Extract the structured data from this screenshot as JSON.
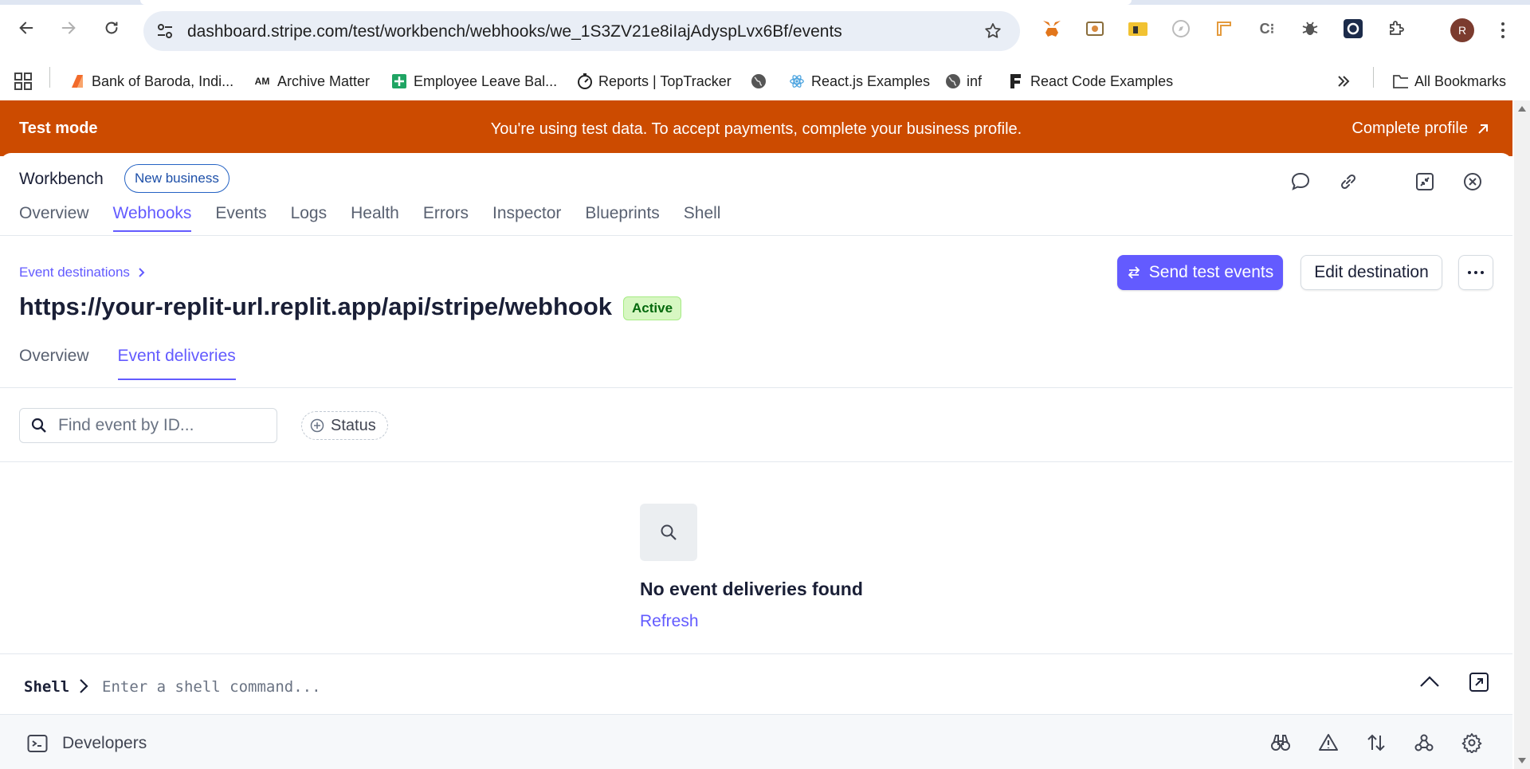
{
  "browser": {
    "url": "dashboard.stripe.com/test/workbench/webhooks/we_1S3ZV21e8iIajAdyspLvx6Bf/events",
    "avatar_letter": "R",
    "bookmarks": [
      {
        "label": "Bank of Baroda, Indi...",
        "icon": "bank-of-baroda-icon"
      },
      {
        "label": "Archive Matter",
        "icon": "archive-matter-icon"
      },
      {
        "label": "Employee Leave Bal...",
        "icon": "sheets-icon"
      },
      {
        "label": "Reports | TopTracker",
        "icon": "toptracker-icon"
      },
      {
        "label": "",
        "icon": "globe-icon"
      },
      {
        "label": "React.js Examples",
        "icon": "react-icon"
      },
      {
        "label": "inf",
        "icon": "globe-icon"
      },
      {
        "label": "React Code Examples",
        "icon": "react-code-icon"
      }
    ],
    "all_bookmarks_label": "All Bookmarks",
    "bookmarks_am_text": "AM"
  },
  "banner": {
    "mode_label": "Test mode",
    "message": "You're using test data. To accept payments, complete your business profile.",
    "cta_label": "Complete profile",
    "color": "#cc4b00"
  },
  "workbench": {
    "title": "Workbench",
    "business_badge": "New business",
    "tabs": [
      {
        "label": "Overview",
        "active": false
      },
      {
        "label": "Webhooks",
        "active": true
      },
      {
        "label": "Events",
        "active": false
      },
      {
        "label": "Logs",
        "active": false
      },
      {
        "label": "Health",
        "active": false
      },
      {
        "label": "Errors",
        "active": false
      },
      {
        "label": "Inspector",
        "active": false
      },
      {
        "label": "Blueprints",
        "active": false
      },
      {
        "label": "Shell",
        "active": false
      }
    ]
  },
  "destination": {
    "breadcrumb": "Event destinations",
    "endpoint_url": "https://your-replit-url.replit.app/api/stripe/webhook",
    "status": "Active",
    "send_test_label": "Send test events",
    "edit_label": "Edit destination",
    "subtabs": [
      {
        "label": "Overview",
        "active": false
      },
      {
        "label": "Event deliveries",
        "active": true
      }
    ],
    "search_placeholder": "Find event by ID...",
    "status_filter_label": "Status",
    "empty_title": "No event deliveries found",
    "refresh_label": "Refresh"
  },
  "shell": {
    "label": "Shell",
    "placeholder": "Enter a shell command..."
  },
  "devbar": {
    "label": "Developers"
  },
  "colors": {
    "accent": "#635bff",
    "active_badge_bg": "#d7f7c2",
    "active_badge_text": "#05690d"
  }
}
